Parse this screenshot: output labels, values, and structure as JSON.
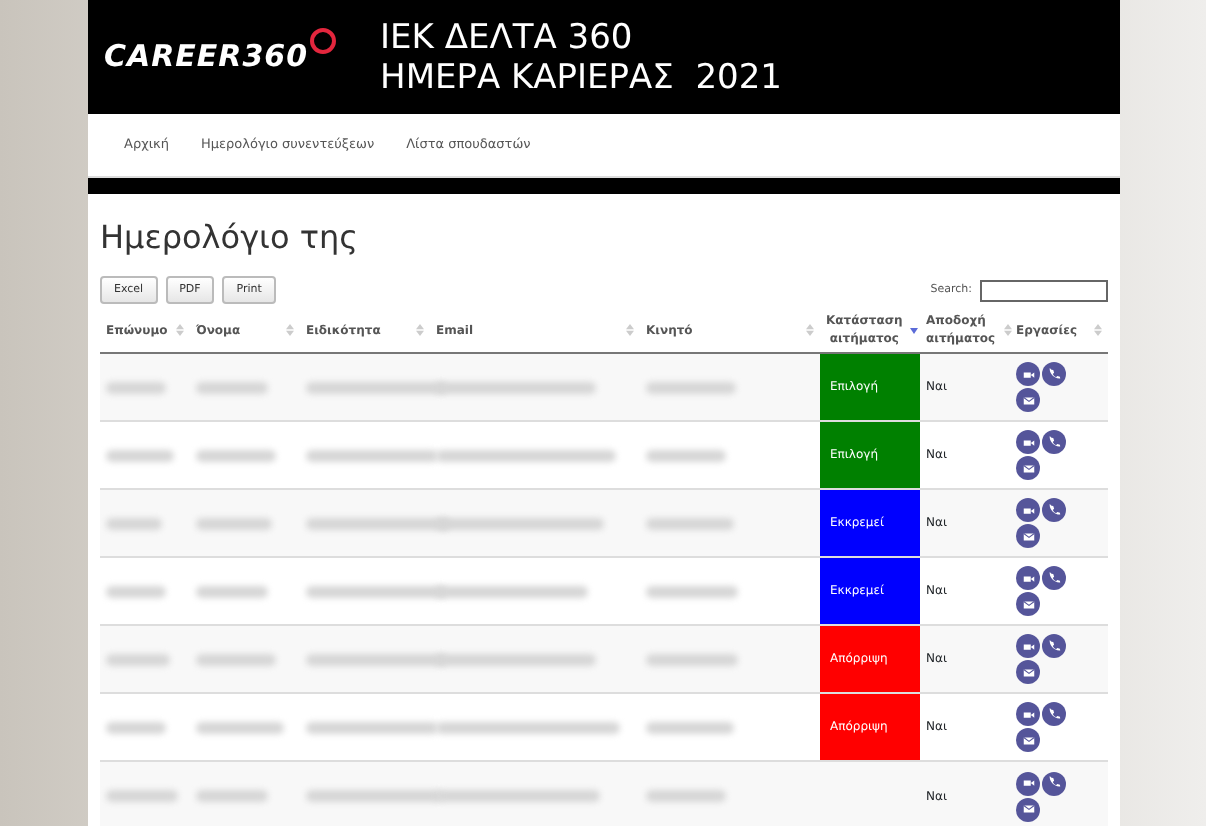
{
  "header": {
    "logo": "CAREER360",
    "title_lines": [
      "ΙΕΚ ΔΕΛΤΑ 360",
      "ΗΜΕΡΑ ΚΑΡΙΕΡΑΣ  2021"
    ]
  },
  "nav": [
    {
      "label": "Αρχική"
    },
    {
      "label": "Ημερολόγιο συνεντεύξεων"
    },
    {
      "label": "Λίστα σπουδαστών"
    }
  ],
  "page_title": "Ημερολόγιο της",
  "export_buttons": [
    "Excel",
    "PDF",
    "Print"
  ],
  "search": {
    "label": "Search:"
  },
  "table": {
    "columns": [
      {
        "label": "Επώνυμο",
        "sorted": false
      },
      {
        "label": "Όνομα",
        "sorted": false
      },
      {
        "label": "Ειδικότητα",
        "sorted": false
      },
      {
        "label": "Email",
        "sorted": false
      },
      {
        "label": "Κινητό",
        "sorted": false
      },
      {
        "label": "Κατάσταση αιτήματος",
        "sorted": true
      },
      {
        "label": "Αποδοχή αιτήματος",
        "sorted": false
      },
      {
        "label": "Εργασίες",
        "sorted": false
      }
    ],
    "rows": [
      {
        "status": {
          "text": "Επιλογή",
          "color": "#008000"
        },
        "accepted": "Ναι"
      },
      {
        "status": {
          "text": "Επιλογή",
          "color": "#008000"
        },
        "accepted": "Ναι"
      },
      {
        "status": {
          "text": "Εκκρεμεί",
          "color": "#0000ff"
        },
        "accepted": "Ναι"
      },
      {
        "status": {
          "text": "Εκκρεμεί",
          "color": "#0000ff"
        },
        "accepted": "Ναι"
      },
      {
        "status": {
          "text": "Απόρριψη",
          "color": "#ff0000"
        },
        "accepted": "Ναι"
      },
      {
        "status": {
          "text": "Απόρριψη",
          "color": "#ff0000"
        },
        "accepted": "Ναι"
      },
      {
        "status": null,
        "accepted": "Ναι"
      }
    ]
  }
}
